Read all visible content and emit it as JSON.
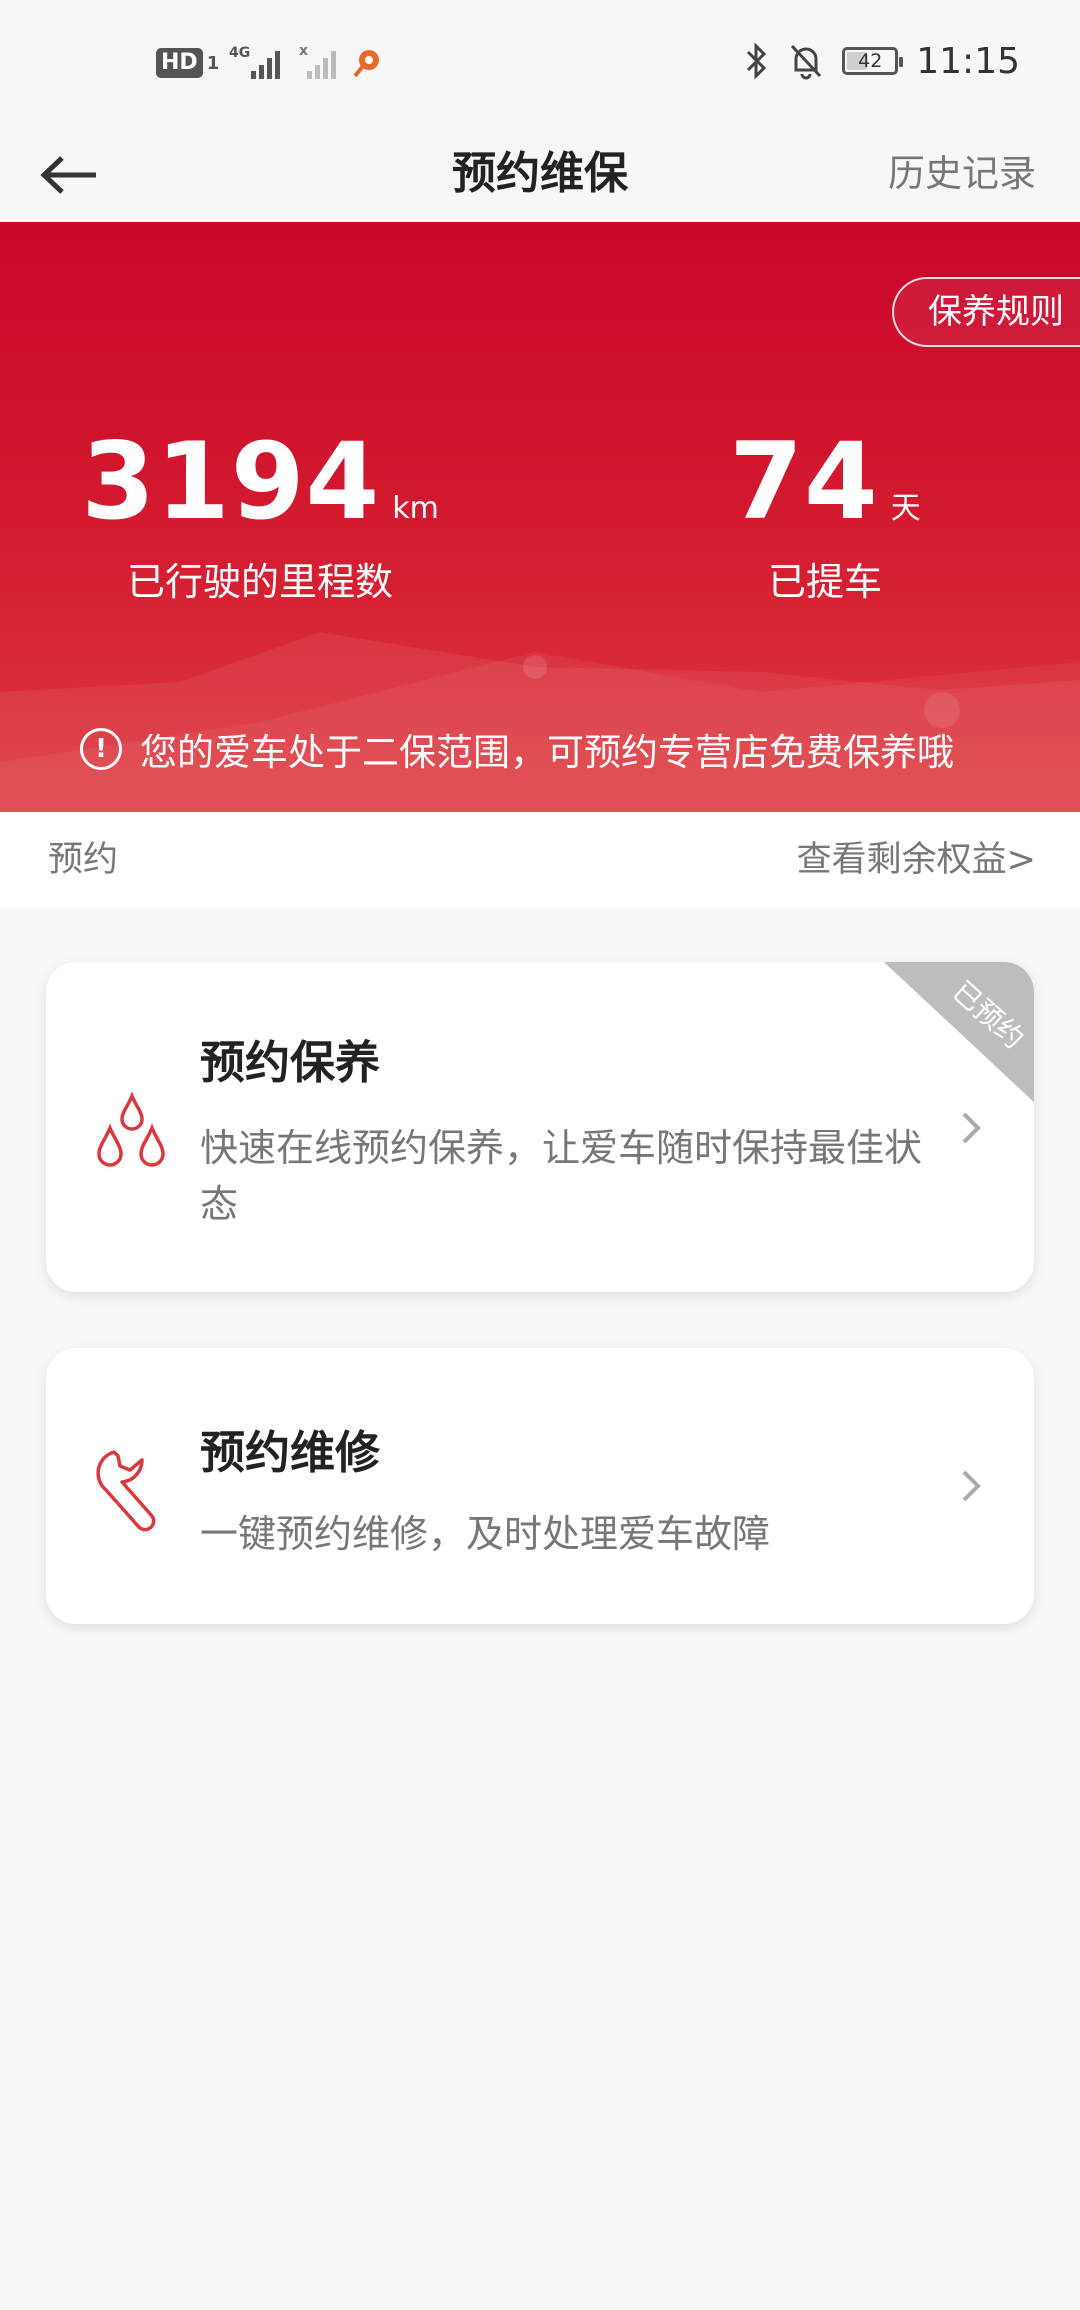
{
  "status_bar": {
    "hd_label": "HD",
    "hd_sub": "1",
    "network": "4G",
    "battery": "42",
    "time": "11:15"
  },
  "header": {
    "title": "预约维保",
    "history_label": "历史记录"
  },
  "banner": {
    "rules_label": "保养规则",
    "mileage_value": "3194",
    "mileage_unit": "km",
    "mileage_label": "已行驶的里程数",
    "days_value": "74",
    "days_unit": "天",
    "days_label": "已提车",
    "notice_icon": "!",
    "notice_text": "您的爱车处于二保范围，可预约专营店免费保养哦"
  },
  "section": {
    "title": "预约",
    "link_label": "查看剩余权益>"
  },
  "cards": [
    {
      "title": "预约保养",
      "desc": "快速在线预约保养，让爱车随时保持最佳状态",
      "badge": "已预约",
      "icon": "drops-icon"
    },
    {
      "title": "预约维修",
      "desc": "一键预约维修，及时处理爱车故障",
      "icon": "wrench-icon"
    }
  ],
  "colors": {
    "brand_red": "#c8062a",
    "icon_red": "#d9383c",
    "badge_gray": "#bdbdbd"
  }
}
